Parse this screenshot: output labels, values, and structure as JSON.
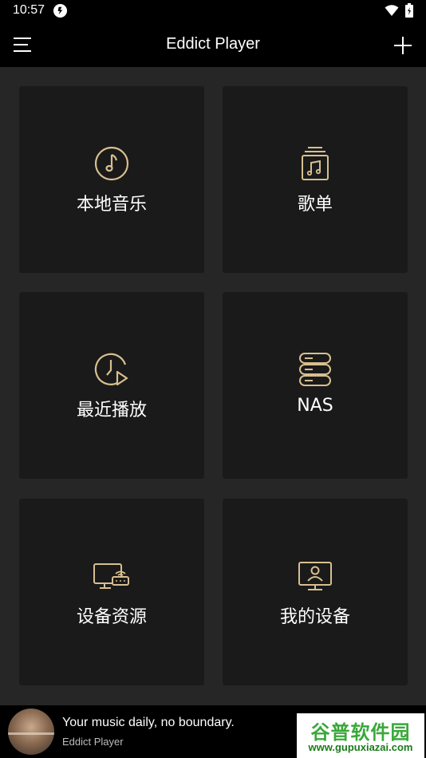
{
  "status_bar": {
    "time": "10:57",
    "icons": [
      "app-notification-icon",
      "wifi-icon",
      "battery-icon"
    ]
  },
  "app_bar": {
    "title": "Eddict Player",
    "left_icon": "menu-icon",
    "right_icon": "add-icon"
  },
  "accent_color": "#d8bf8f",
  "tiles": [
    {
      "label": "本地音乐",
      "icon": "music-note-icon"
    },
    {
      "label": "歌单",
      "icon": "playlist-icon"
    },
    {
      "label": "最近播放",
      "icon": "recent-play-icon"
    },
    {
      "label": "NAS",
      "icon": "nas-server-icon"
    },
    {
      "label": "设备资源",
      "icon": "device-resource-icon"
    },
    {
      "label": "我的设备",
      "icon": "my-device-icon"
    }
  ],
  "mini_player": {
    "title": "Your music daily, no boundary.",
    "subtitle": "Eddict Player"
  },
  "watermark": {
    "text": "谷普软件园",
    "url": "www.gupuxiazai.com"
  }
}
